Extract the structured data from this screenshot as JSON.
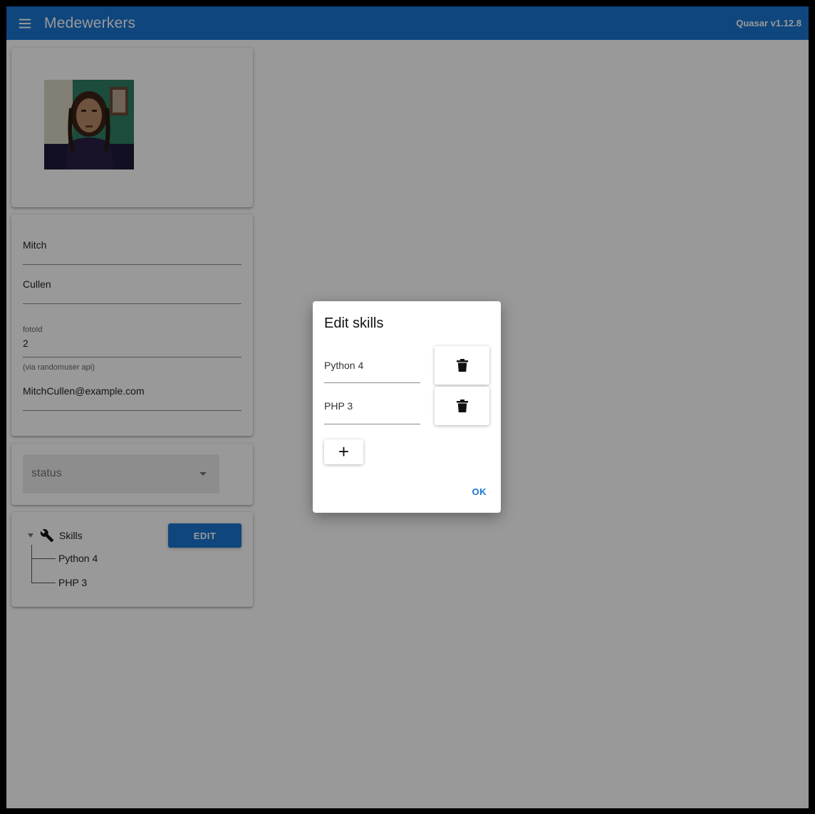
{
  "header": {
    "title": "Medewerkers",
    "version": "Quasar v1.12.8"
  },
  "profile": {
    "first_name": "Mitch",
    "last_name": "Cullen",
    "foto_label": "fotoId",
    "foto_value": "2",
    "email_hint": "(via randomuser api)",
    "email": "MitchCullen@example.com"
  },
  "status": {
    "placeholder": "status"
  },
  "skills_tree": {
    "root_label": "Skills",
    "items": [
      "Python 4",
      "PHP 3"
    ],
    "edit_label": "EDIT"
  },
  "dialog": {
    "title": "Edit skills",
    "skills": [
      "Python 4",
      "PHP 3"
    ],
    "add_label": "+",
    "ok_label": "OK"
  },
  "colors": {
    "primary": "#1976d2",
    "backdrop": "rgba(0,0,0,0.4)"
  }
}
